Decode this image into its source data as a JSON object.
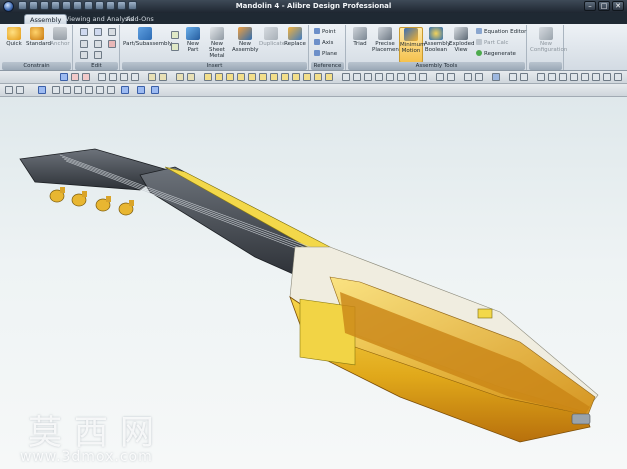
{
  "window": {
    "title": "Mandolin 4 - Alibre Design Professional",
    "controls": [
      "–",
      "□",
      "✕"
    ]
  },
  "tabs": [
    {
      "label": "Assembly",
      "active": true
    },
    {
      "label": "Viewing and Analysis",
      "active": false
    },
    {
      "label": "Add-Ons",
      "active": false
    }
  ],
  "ribbon": {
    "constrain": {
      "label": "Constrain",
      "buttons": [
        "Quick",
        "Standard",
        "Anchor"
      ]
    },
    "edit": {
      "label": "Edit"
    },
    "insert": {
      "label": "Insert",
      "buttons": [
        "Part/Subassembly",
        "New Part",
        "New Sheet Metal",
        "New Assembly",
        "Duplicate",
        "Replace"
      ]
    },
    "reference": {
      "label": "Reference",
      "buttons": [
        "Point",
        "Axis",
        "Plane"
      ]
    },
    "assembly_tools": {
      "label": "Assembly Tools",
      "buttons": [
        "Triad",
        "Precise Placement",
        "Minimum Motion",
        "Assembly Boolean",
        "Exploded View"
      ],
      "side_buttons": [
        "Equation Editor",
        "Part Calc",
        "Regenerate"
      ]
    },
    "configuration": {
      "buttons": [
        "New Configuration"
      ]
    }
  },
  "watermark": {
    "chinese": "莫西网",
    "url": "www.3dmox.com"
  },
  "colors": {
    "accent": "#f6c24e",
    "body_gold": "#e0a81a",
    "neck_dark": "#3a3e45"
  }
}
